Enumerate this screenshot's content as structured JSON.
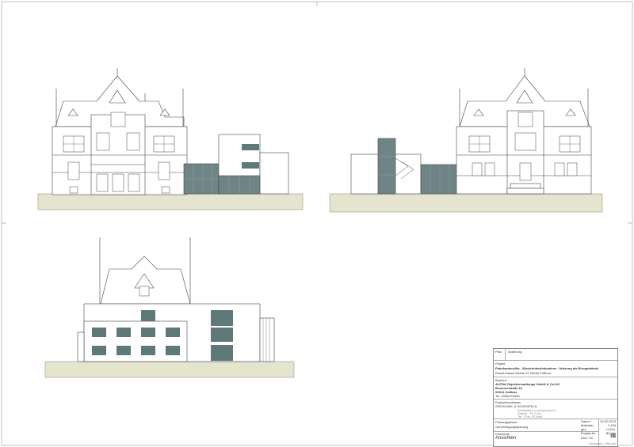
{
  "title_block": {
    "header_labels": [
      "Plan",
      "Änderung"
    ],
    "project_label": "Projekt",
    "project_title": "Fabrikantenvilla - Wiederinbetriebnahme - Nutzung als Bürogebäude",
    "project_address": "Ewald-Haase-Straße 51    03046 Cottbus",
    "client_label": "Bauherr",
    "client_name": "ALPHA Objektverwaltungs GmbH & Co.KG",
    "client_street": "Brunnenstraße 16",
    "client_city": "03044 Cottbus",
    "client_phone": "Tel. 0355/472646",
    "architect_label": "Entwurfsverfasser",
    "architect_name": "GRÖSCHEL & SCHÖNFELD",
    "architect_details": [
      "Architekten und Ingenieure",
      "Straße · PLZ Ort",
      "Tel. / Fax / E-Mail"
    ],
    "phase_label": "Planungsphase",
    "phase": "Genehmigungsplanung",
    "content_label": "Planinhalt",
    "content": "Ansichten",
    "meta": [
      {
        "label": "Datum",
        "value": "19.02.2013"
      },
      {
        "label": "Maßstab",
        "value": "1:100"
      },
      {
        "label": "gez.",
        "value": "H.Sch."
      },
      {
        "label": "Projekt-Nr.",
        "value": "BVvilla"
      }
    ],
    "sheet_code": "A94 / 00",
    "sheet_number": "08",
    "file_name": "Ansichten_Villa.pln"
  },
  "colors": {
    "ground": "#e4e4cf",
    "ground_stroke": "#999988",
    "glass": "#6f8585",
    "window": "#5f7878",
    "line": "#444444"
  }
}
